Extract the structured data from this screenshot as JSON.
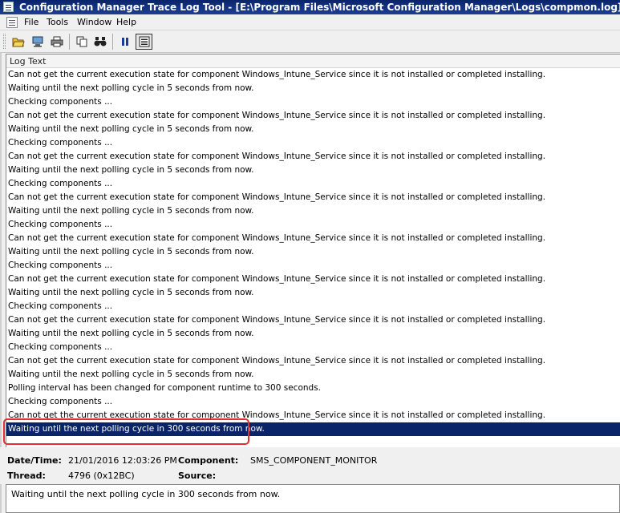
{
  "window": {
    "title": "Configuration Manager Trace Log Tool - [E:\\Program Files\\Microsoft Configuration Manager\\Logs\\compmon.log]"
  },
  "menu": [
    "File",
    "Tools",
    "Window",
    "Help"
  ],
  "toolbar": {
    "buttons": [
      "open-folder-icon",
      "open-on-server-icon",
      "print-icon",
      "copy-icon",
      "find-icon",
      "pause-icon",
      "highlight-icon"
    ]
  },
  "log": {
    "column_header": "Log Text",
    "rows": [
      "Can not get the current execution state for component Windows_Intune_Service since it is not installed or completed installing.",
      "Waiting until the next polling cycle in 5 seconds from now.",
      "Checking components ...",
      "Can not get the current execution state for component Windows_Intune_Service since it is not installed or completed installing.",
      "Waiting until the next polling cycle in 5 seconds from now.",
      "Checking components ...",
      "Can not get the current execution state for component Windows_Intune_Service since it is not installed or completed installing.",
      "Waiting until the next polling cycle in 5 seconds from now.",
      "Checking components ...",
      "Can not get the current execution state for component Windows_Intune_Service since it is not installed or completed installing.",
      "Waiting until the next polling cycle in 5 seconds from now.",
      "Checking components ...",
      "Can not get the current execution state for component Windows_Intune_Service since it is not installed or completed installing.",
      "Waiting until the next polling cycle in 5 seconds from now.",
      "Checking components ...",
      "Can not get the current execution state for component Windows_Intune_Service since it is not installed or completed installing.",
      "Waiting until the next polling cycle in 5 seconds from now.",
      "Checking components ...",
      "Can not get the current execution state for component Windows_Intune_Service since it is not installed or completed installing.",
      "Waiting until the next polling cycle in 5 seconds from now.",
      "Checking components ...",
      "Can not get the current execution state for component Windows_Intune_Service since it is not installed or completed installing.",
      "Waiting until the next polling cycle in 5 seconds from now.",
      "Polling interval has been changed for component runtime to 300 seconds.",
      "Checking components ...",
      "Can not get the current execution state for component Windows_Intune_Service since it is not installed or completed installing.",
      "Waiting until the next polling cycle in 300 seconds from now."
    ],
    "selected_index": 26
  },
  "details": {
    "datetime_label": "Date/Time:",
    "datetime_value": "21/01/2016 12:03:26 PM",
    "component_label": "Component:",
    "component_value": "SMS_COMPONENT_MONITOR",
    "thread_label": "Thread:",
    "thread_value": "4796 (0x12BC)",
    "source_label": "Source:",
    "source_value": ""
  },
  "message": "Waiting until the next polling cycle in 300 seconds from now.",
  "colors": {
    "title_bar": "#0a246a",
    "selection": "#0a246a",
    "annotation": "#e03030"
  }
}
